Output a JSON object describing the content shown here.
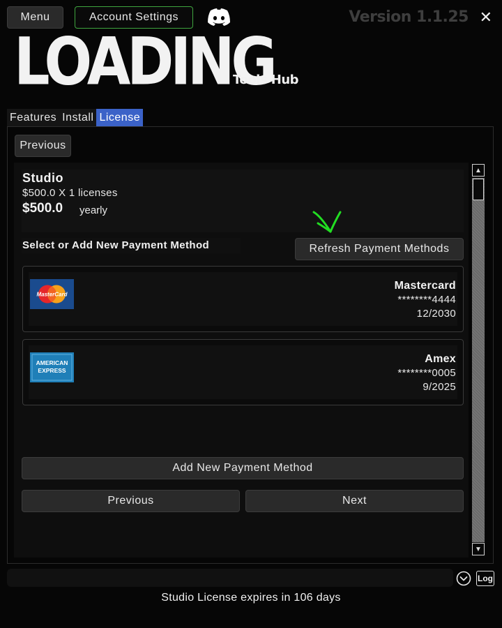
{
  "header": {
    "menu_label": "Menu",
    "account_label": "Account Settings",
    "version": "Version 1.1.25",
    "close_glyph": "✕",
    "logo_text": "LOADING",
    "subtitle": "Tools Hub",
    "discord_icon": "discord-icon"
  },
  "tabs": [
    {
      "label": "Features",
      "active": false
    },
    {
      "label": "Install",
      "active": false
    },
    {
      "label": "License",
      "active": true
    }
  ],
  "nav": {
    "previous_label": "Previous"
  },
  "plan": {
    "name": "Studio",
    "calculation": "$500.0 X 1 licenses",
    "total": "$500.0",
    "period": "yearly"
  },
  "payment": {
    "section_label": "Select or Add New Payment Method",
    "refresh_label": "Refresh Payment Methods",
    "cards": [
      {
        "brand": "Mastercard",
        "number": "********4444",
        "expiry": "12/2030",
        "icon": "mastercard-icon"
      },
      {
        "brand": "Amex",
        "number": "********0005",
        "expiry": "9/2025",
        "icon": "amex-icon"
      }
    ],
    "add_label": "Add New Payment Method"
  },
  "footer_buttons": {
    "previous_label": "Previous",
    "next_label": "Next"
  },
  "status": {
    "expiry_text": "Studio License expires in 106 days",
    "log_label": "Log"
  },
  "colors": {
    "accent_tab": "#3b62c8",
    "account_border": "#3fa63f",
    "annotation_arrow": "#22dd22"
  }
}
